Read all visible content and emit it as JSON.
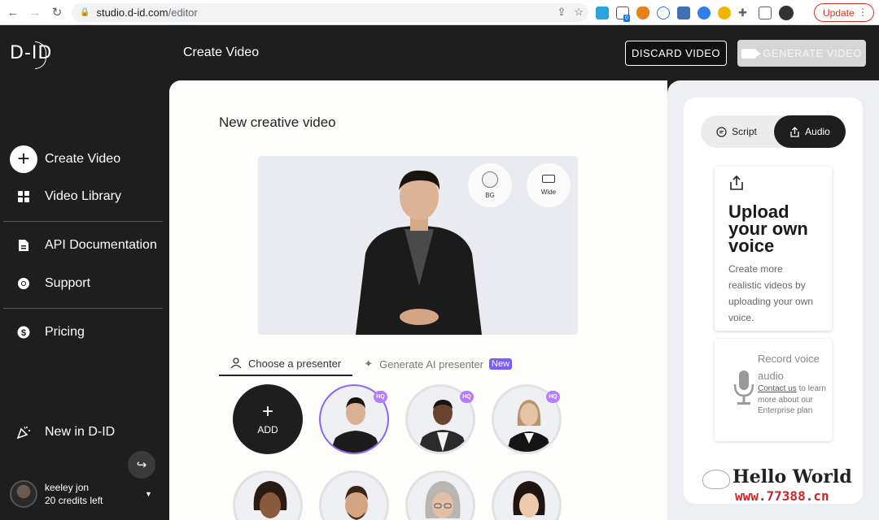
{
  "browser": {
    "url_host": "studio.d-id.com",
    "url_path": "/editor",
    "update_label": "Update",
    "extension_badge": "0"
  },
  "sidebar": {
    "logo": "D-ID",
    "items": [
      {
        "label": "Create Video",
        "icon": "plus-circle-icon"
      },
      {
        "label": "Video Library",
        "icon": "grid-icon"
      },
      {
        "label": "API Documentation",
        "icon": "document-icon"
      },
      {
        "label": "Support",
        "icon": "lifebuoy-icon"
      },
      {
        "label": "Pricing",
        "icon": "dollar-icon"
      },
      {
        "label": "New in D-ID",
        "icon": "party-popper-icon"
      }
    ],
    "user": {
      "name": "keeley jon",
      "credits": "20 credits left"
    }
  },
  "header": {
    "title": "Create Video",
    "discard_label": "DISCARD VIDEO",
    "generate_label": "GENERATE VIDEO"
  },
  "main": {
    "title": "New creative video",
    "preview_controls": {
      "bg_label": "BG",
      "wide_label": "Wide"
    },
    "tabs": [
      {
        "label": "Choose a presenter",
        "active": true
      },
      {
        "label": "Generate AI presenter",
        "badge": "New",
        "active": false
      }
    ],
    "add_label": "ADD",
    "hq_label": "HQ"
  },
  "right_panel": {
    "script_label": "Script",
    "audio_label": "Audio",
    "upload_title": "Upload your own voice",
    "upload_desc": "Create more realistic videos by uploading your own voice.",
    "record_title": "Record voice audio",
    "record_link": "Contact us",
    "record_desc": "to learn more about our Enterprise plan"
  },
  "watermark": {
    "line1": "Hello World",
    "line2": "www.77388.cn"
  },
  "colors": {
    "accent": "#8e63ff",
    "hq_badge": "#b67cff",
    "new_badge": "#7c5cff",
    "dark": "#1e1e1e",
    "update_red": "#d93025"
  }
}
